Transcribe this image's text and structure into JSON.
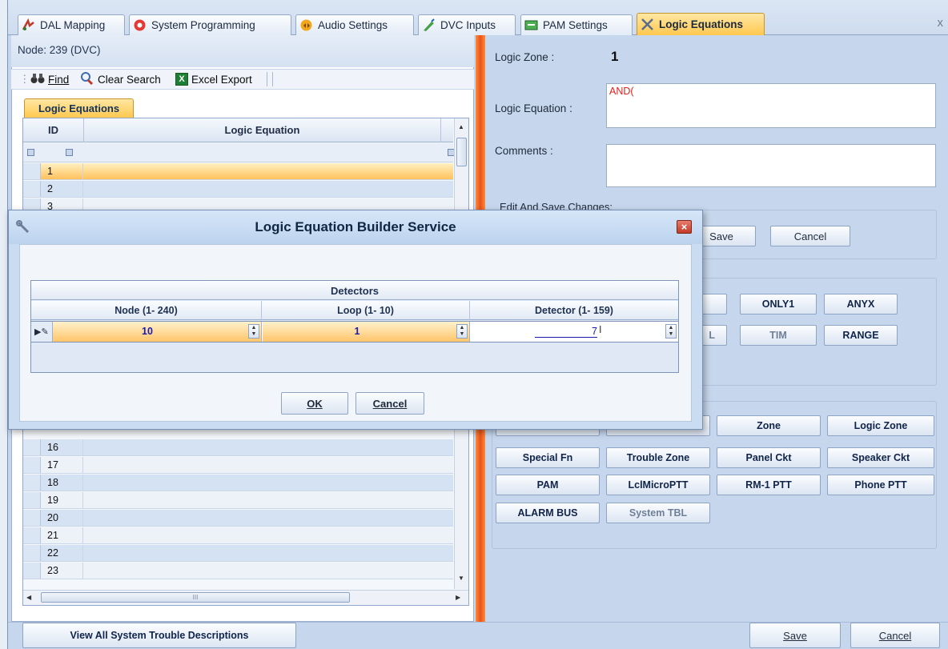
{
  "tabs": [
    {
      "label": "DAL Mapping",
      "icon": "dal-mapping-icon"
    },
    {
      "label": "System Programming",
      "icon": "system-programming-icon"
    },
    {
      "label": "Audio Settings",
      "icon": "audio-settings-icon"
    },
    {
      "label": "DVC Inputs",
      "icon": "dvc-inputs-icon"
    },
    {
      "label": "PAM Settings",
      "icon": "pam-settings-icon"
    },
    {
      "label": "Logic Equations",
      "icon": "logic-equations-icon",
      "active": true
    }
  ],
  "close_glyph": "x",
  "left": {
    "node_label": "Node: 239 (DVC)",
    "toolbar": {
      "find": "Find",
      "clear_search": "Clear Search",
      "excel_export": "Excel Export"
    },
    "subtab": "Logic Equations",
    "grid": {
      "col_id": "ID",
      "col_equation": "Logic Equation",
      "rows_top": [
        "1",
        "2",
        "3"
      ],
      "rows_bottom": [
        "16",
        "17",
        "18",
        "19",
        "20",
        "21",
        "22",
        "23"
      ],
      "selected_row": "1",
      "hscroll_grip": "III"
    }
  },
  "right": {
    "logic_zone_label": "Logic Zone :",
    "logic_zone_value": "1",
    "logic_equation_label": "Logic Equation :",
    "logic_equation_value": "AND(",
    "comments_label": "Comments :",
    "comments_value": "",
    "edit_save_label": "Edit And Save Changes:",
    "save_partial": "Save",
    "cancel": "Cancel",
    "operator_buttons": [
      "ONLY1",
      "ANYX",
      "L",
      "TIM",
      "RANGE"
    ],
    "type_buttons": [
      [
        "Zone",
        "Logic Zone"
      ],
      [
        "Special Fn",
        "Trouble Zone",
        "Panel Ckt",
        "Speaker Ckt"
      ],
      [
        "PAM",
        "LclMicroPTT",
        "RM-1 PTT",
        "Phone PTT"
      ],
      [
        "ALARM BUS",
        "System TBL"
      ]
    ]
  },
  "bottom": {
    "view_all": "View All System Trouble Descriptions",
    "save": "Save",
    "cancel": "Cancel"
  },
  "dialog": {
    "title": "Logic Equation Builder Service",
    "group_header": "Detectors",
    "columns": [
      "Node (1- 240)",
      "Loop (1- 10)",
      "Detector (1- 159)"
    ],
    "values": {
      "node": "10",
      "loop": "1",
      "detector": "7"
    },
    "ok": "OK",
    "cancel": "Cancel",
    "close_glyph": "×"
  },
  "colors": {
    "accent_orange": "#ffc84f",
    "splitter": "#e8531a",
    "equation_text": "#e0201a",
    "panel_blue": "#c6d6ec"
  }
}
